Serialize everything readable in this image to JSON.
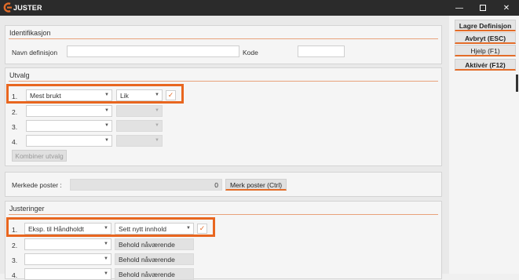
{
  "window": {
    "title": "JUSTER",
    "accent": "#e36c28"
  },
  "identifikasjon": {
    "heading": "Identifikasjon",
    "name_label": "Navn definisjon",
    "name_value": "",
    "code_label": "Kode",
    "code_value": ""
  },
  "utvalg": {
    "heading": "Utvalg",
    "rows": [
      {
        "num": "1.",
        "field": "Mest brukt",
        "op": "Lik",
        "checked": true
      },
      {
        "num": "2.",
        "field": "",
        "op": ""
      },
      {
        "num": "3.",
        "field": "",
        "op": ""
      },
      {
        "num": "4.",
        "field": "",
        "op": ""
      }
    ],
    "combine_label": "Kombiner utvalg"
  },
  "merkede": {
    "label": "Merkede poster :",
    "count": "0",
    "button": "Merk poster (Ctrl)"
  },
  "justeringer": {
    "heading": "Justeringer",
    "rows": [
      {
        "num": "1.",
        "field": "Eksp. til Håndholdt",
        "action": "Sett nytt innhold",
        "checked": true
      },
      {
        "num": "2.",
        "field": "",
        "action": "Behold nåværende"
      },
      {
        "num": "3.",
        "field": "",
        "action": "Behold nåværende"
      },
      {
        "num": "4.",
        "field": "",
        "action": "Behold nåværende"
      }
    ]
  },
  "actions": {
    "lagre": "Lagre Definisjon",
    "avbryt": "Avbryt (ESC)",
    "hjelp": "Hjelp (F1)",
    "aktiver": "Aktivér (F12)"
  },
  "icons": {
    "dropdown": "chevron-down-icon",
    "check": "checkmark-icon",
    "minimize": "minimize-icon",
    "maximize": "maximize-icon",
    "close": "close-icon"
  }
}
